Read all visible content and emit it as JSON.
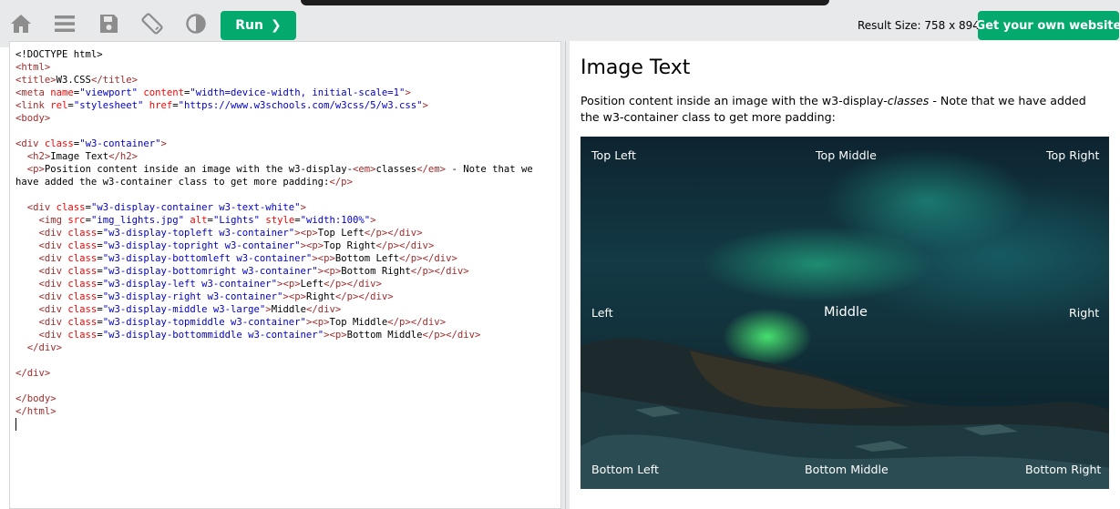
{
  "toolbar": {
    "run_label": "Run",
    "run_chevron": "❯",
    "result_size": "Result Size: 758 x 894",
    "cta_label": "Get your own website",
    "icons": [
      "home-icon",
      "menu-icon",
      "save-icon",
      "rotate-icon",
      "contrast-icon"
    ],
    "accent_color": "#04aa6d"
  },
  "editor": {
    "lines": [
      "<!DOCTYPE html>",
      "<html>",
      "<title>W3.CSS</title>",
      "<meta name=\"viewport\" content=\"width=device-width, initial-scale=1\">",
      "<link rel=\"stylesheet\" href=\"https://www.w3schools.com/w3css/5/w3.css\">",
      "<body>",
      "",
      "<div class=\"w3-container\">",
      "  <h2>Image Text</h2>",
      "  <p>Position content inside an image with the w3-display-<em>classes</em> - Note that we",
      "have added the w3-container class to get more padding:</p>",
      "",
      "  <div class=\"w3-display-container w3-text-white\">",
      "    <img src=\"img_lights.jpg\" alt=\"Lights\" style=\"width:100%\">",
      "    <div class=\"w3-display-topleft w3-container\"><p>Top Left</p></div>",
      "    <div class=\"w3-display-topright w3-container\"><p>Top Right</p></div>",
      "    <div class=\"w3-display-bottomleft w3-container\"><p>Bottom Left</p></div>",
      "    <div class=\"w3-display-bottomright w3-container\"><p>Bottom Right</p></div>",
      "    <div class=\"w3-display-left w3-container\"><p>Left</p></div>",
      "    <div class=\"w3-display-right w3-container\"><p>Right</p></div>",
      "    <div class=\"w3-display-middle w3-large\">Middle</div>",
      "    <div class=\"w3-display-topmiddle w3-container\"><p>Top Middle</p></div>",
      "    <div class=\"w3-display-bottommiddle w3-container\"><p>Bottom Middle</p></div>",
      "  </div>",
      "",
      "</div>",
      "",
      "</body>",
      "</html>"
    ]
  },
  "result": {
    "title": "Image Text",
    "para_before": "Position content inside an image with the w3-display-",
    "para_em": "classes",
    "para_after": " - Note that we have added the w3-container class to get more padding:",
    "image_alt": "Lights",
    "labels": {
      "top_left": "Top Left",
      "top_middle": "Top Middle",
      "top_right": "Top Right",
      "left": "Left",
      "middle": "Middle",
      "right": "Right",
      "bottom_left": "Bottom Left",
      "bottom_middle": "Bottom Middle",
      "bottom_right": "Bottom Right"
    }
  }
}
